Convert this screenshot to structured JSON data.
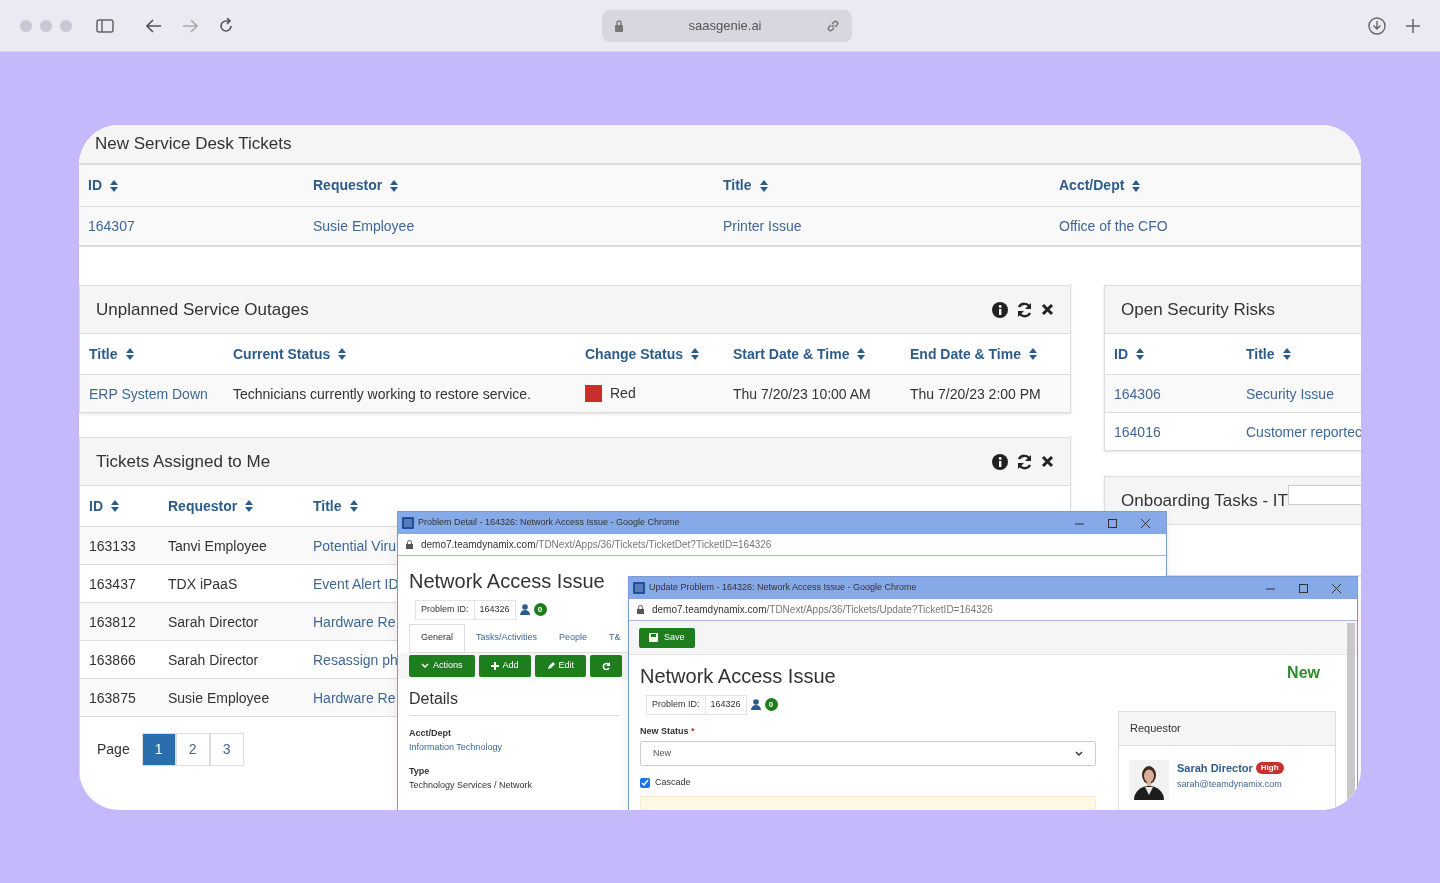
{
  "browser": {
    "url": "saasgenie.ai"
  },
  "new_tickets": {
    "title": "New Service Desk Tickets",
    "columns": [
      "ID",
      "Requestor",
      "Title",
      "Acct/Dept"
    ],
    "rows": [
      [
        "164307",
        "Susie Employee",
        "Printer Issue",
        "Office of the CFO"
      ]
    ]
  },
  "outages": {
    "title": "Unplanned Service Outages",
    "columns": [
      "Title",
      "Current Status",
      "Change Status",
      "Start Date & Time",
      "End Date & Time"
    ],
    "rows": [
      {
        "title": "ERP System Down",
        "current_status": "Technicians currently working to restore service.",
        "change_status": "Red",
        "color": "#c9302c",
        "start": "Thu 7/20/23 10:00 AM",
        "end": "Thu 7/20/23 2:00 PM"
      }
    ]
  },
  "assigned": {
    "title": "Tickets Assigned to Me",
    "columns": [
      "ID",
      "Requestor",
      "Title"
    ],
    "rows": [
      [
        "163133",
        "Tanvi Employee",
        "Potential Viru"
      ],
      [
        "163437",
        "TDX iPaaS",
        "Event Alert ID"
      ],
      [
        "163812",
        "Sarah Director",
        "Hardware Re"
      ],
      [
        "163866",
        "Sarah Director",
        "Resassign ph"
      ],
      [
        "163875",
        "Susie Employee",
        "Hardware Re"
      ]
    ],
    "page_label": "Page",
    "pages": [
      {
        "label": "1",
        "selected": true
      },
      {
        "label": "2",
        "selected": false
      },
      {
        "label": "3",
        "selected": false
      }
    ]
  },
  "security": {
    "title": "Open Security Risks",
    "columns": [
      "ID",
      "Title"
    ],
    "rows": [
      [
        "164306",
        "Security Issue"
      ],
      [
        "164016",
        "Customer reportec"
      ]
    ]
  },
  "onboarding": {
    "title": "Onboarding Tasks - IT"
  },
  "problem_window": {
    "title": "Problem Detail - 164326: Network Access Issue - Google Chrome",
    "url_host": "demo7.teamdynamix.com",
    "url_path": "/TDNext/Apps/36/Tickets/TicketDet?TicketID=164326",
    "heading": "Network Access Issue",
    "id_label": "Problem ID:",
    "id_value": "164326",
    "count": "0",
    "tabs": [
      {
        "label": "General",
        "selected": true
      },
      {
        "label": "Tasks/Activities",
        "selected": false
      },
      {
        "label": "People",
        "selected": false
      },
      {
        "label": "T&",
        "selected": false
      }
    ],
    "buttons": [
      {
        "kind": "actions",
        "label": "Actions"
      },
      {
        "kind": "add",
        "label": "Add"
      },
      {
        "kind": "edit",
        "label": "Edit"
      },
      {
        "kind": "refresh"
      }
    ],
    "section": "Details",
    "fields": [
      {
        "label": "Acct/Dept",
        "value": "Information Technology",
        "link": true
      },
      {
        "label": "Type",
        "value": "Technology Services / Network",
        "link": false
      }
    ]
  },
  "update_window": {
    "title": "Update Problem - 164326: Network Access Issue - Google Chrome",
    "url_host": "demo7.teamdynamix.com",
    "url_path": "/TDNext/Apps/36/Tickets/Update?TicketID=164326",
    "save": "Save",
    "heading": "Network Access Issue",
    "status": "New",
    "id_label": "Problem ID:",
    "id_value": "164326",
    "count": "0",
    "new_status_label": "New Status",
    "required": "*",
    "new_status_value": "New",
    "cascade": {
      "label": "Cascade",
      "checked": true
    },
    "requestor": {
      "title": "Requestor",
      "name": "Sarah Director",
      "priority": "High",
      "email": "sarah@teamdynamix.com"
    }
  }
}
